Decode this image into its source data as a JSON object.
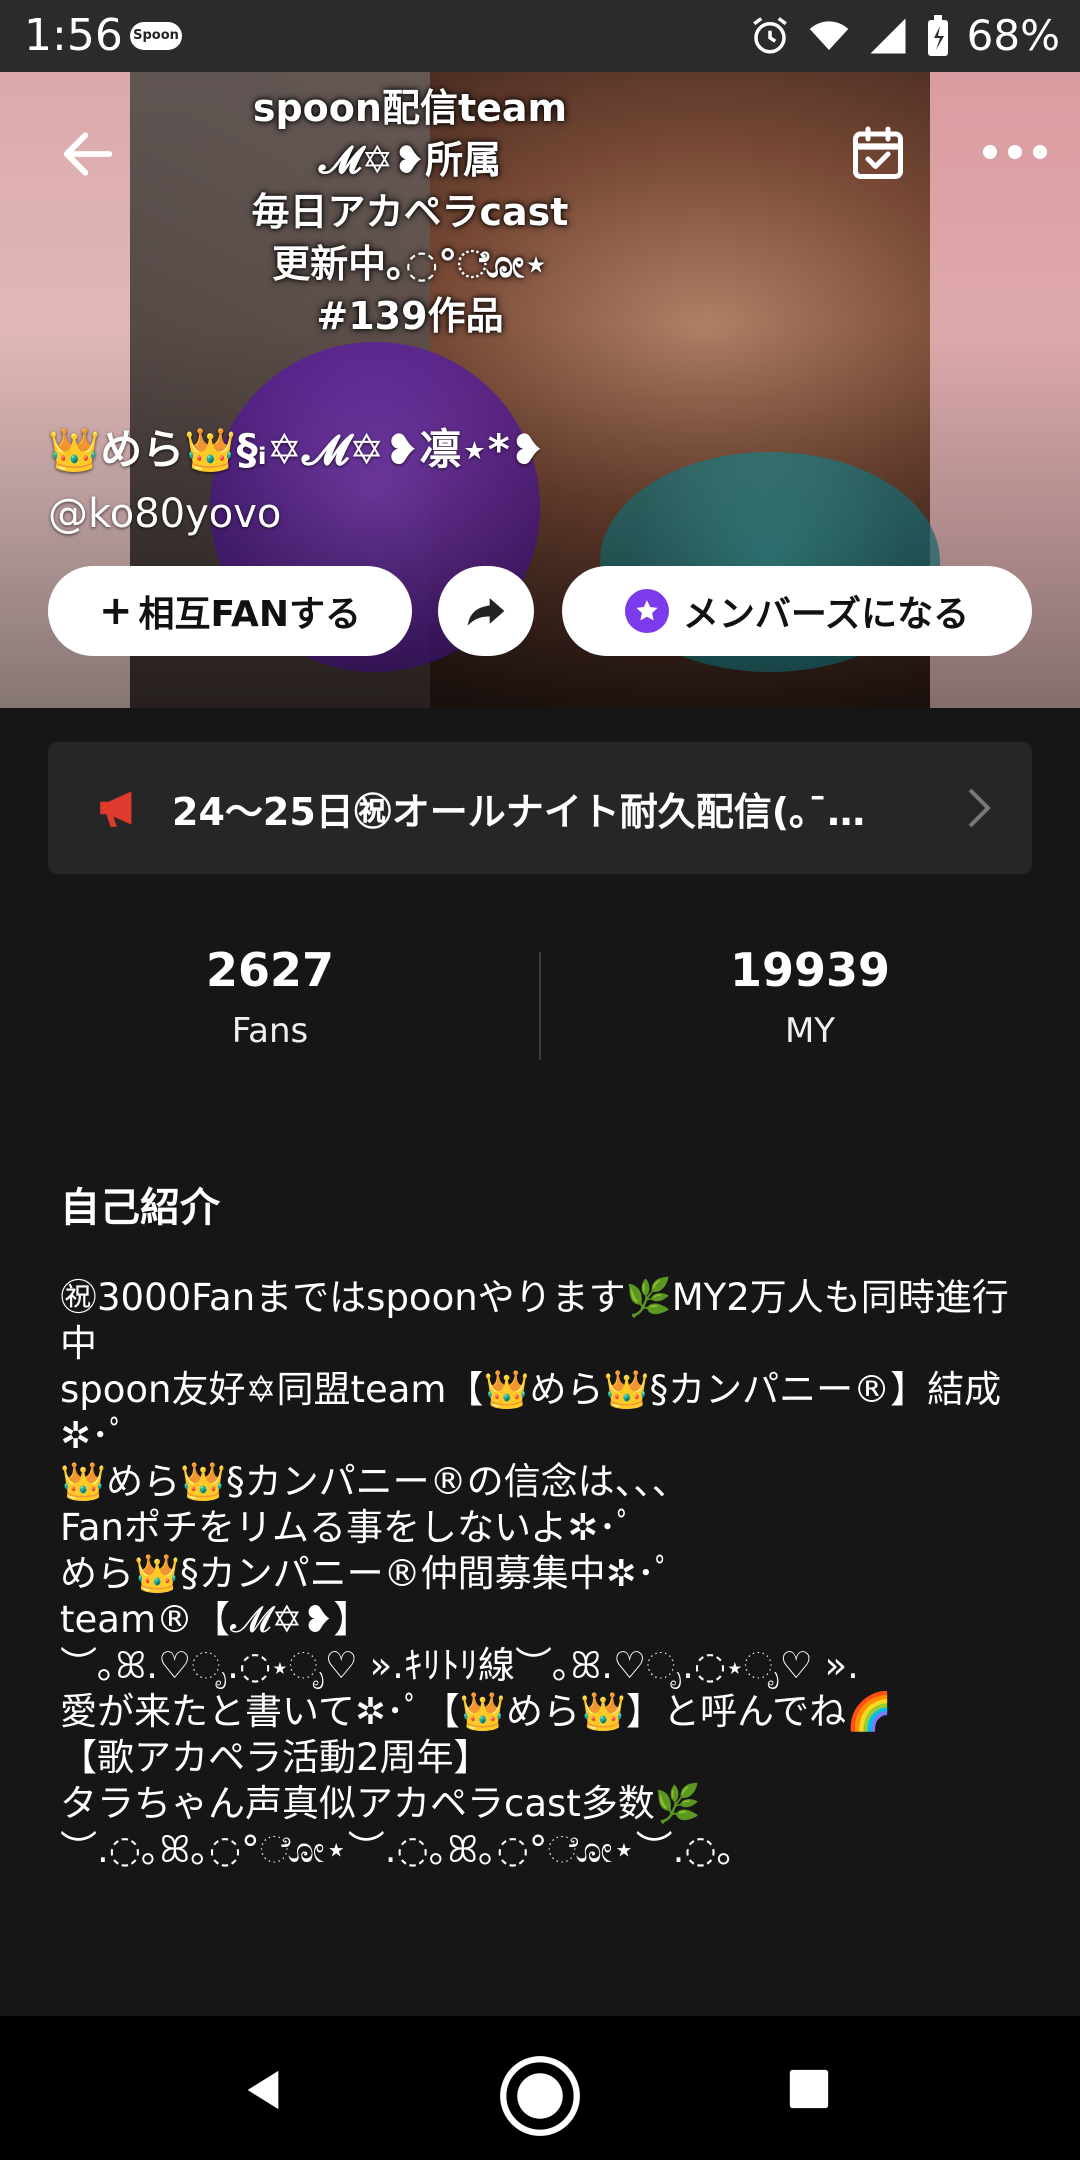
{
  "status_bar": {
    "time": "1:56",
    "app_badge": "Spoon",
    "battery_percent": "68%"
  },
  "hero": {
    "overlay_lines": [
      "spoon配信team",
      "𝓜✡❥所属",
      "毎日アカペラcast",
      "更新中｡◌°ೋ⋆",
      "#139作品"
    ]
  },
  "profile": {
    "name": "👑めら👑§ᵢ✡𝓜✡❥凛⋆*❥",
    "handle": "@ko80yovo"
  },
  "actions": {
    "fan_label": "相互FANする",
    "member_label": "メンバーズになる"
  },
  "announcement": {
    "text": "24〜25日㊗オールナイト耐久配信(｡¯…"
  },
  "stats": {
    "fans_count": "2627",
    "fans_label": "Fans",
    "my_count": "19939",
    "my_label": "MY"
  },
  "bio": {
    "title": "自己紹介",
    "text": "㊗3000Fanまではspoonやります🌿MY2万人も同時進行中\nspoon友好✡同盟team【👑めら👑§カンパニー®】結成✲･ﾟ\n👑めら👑§カンパニー®の信念は、、、\nFanポチをリムる事をしないよ✲･ﾟ\nめら👑§カンパニー®仲間募集中✲･ﾟ\nteam®【𝓜✡❥】\n︶｡ꕤ.♡ೃ.◌⋆ೃ♡ ».ｷﾘﾄﾘ線︶｡ꕤ.♡ೃ.◌⋆ೃ♡ ».\n愛が来たと書いて✲･ﾟ【👑めら👑】と呼んでね🌈\n【歌アカペラ活動2周年】\nタラちゃん声真似アカペラcast多数🌿\n︶.◌｡ꕤ｡◌°ೋ⋆︶.◌｡ꕤ｡◌°ೋ⋆︶.◌｡"
  },
  "colors": {
    "background": "#161616",
    "card": "#262626",
    "accent_member": "#7c3aed",
    "megaphone": "#e03a2e"
  },
  "icons": [
    "back-arrow-icon",
    "calendar-check-icon",
    "more-horizontal-icon",
    "plus-icon",
    "share-icon",
    "members-star-icon",
    "megaphone-icon",
    "chevron-right-icon",
    "nav-back-icon",
    "nav-home-icon",
    "nav-recent-icon",
    "alarm-icon",
    "wifi-icon",
    "signal-icon",
    "battery-icon"
  ]
}
